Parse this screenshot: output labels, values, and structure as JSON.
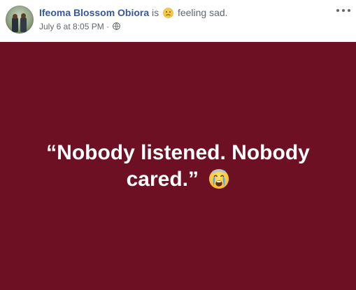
{
  "post": {
    "author": "Ifeoma Blossom Obiora",
    "activity_prefix": "is",
    "feeling_icon": "sad-face-emoji",
    "feeling_text": "feeling sad.",
    "timestamp": "July 6 at 8:05 PM",
    "separator": "·",
    "audience_icon": "globe-icon",
    "status_text": "“Nobody listened. Nobody cared.”",
    "status_emoji": "crying-face-emoji",
    "background_color": "#6e1023",
    "author_color": "#385898"
  }
}
